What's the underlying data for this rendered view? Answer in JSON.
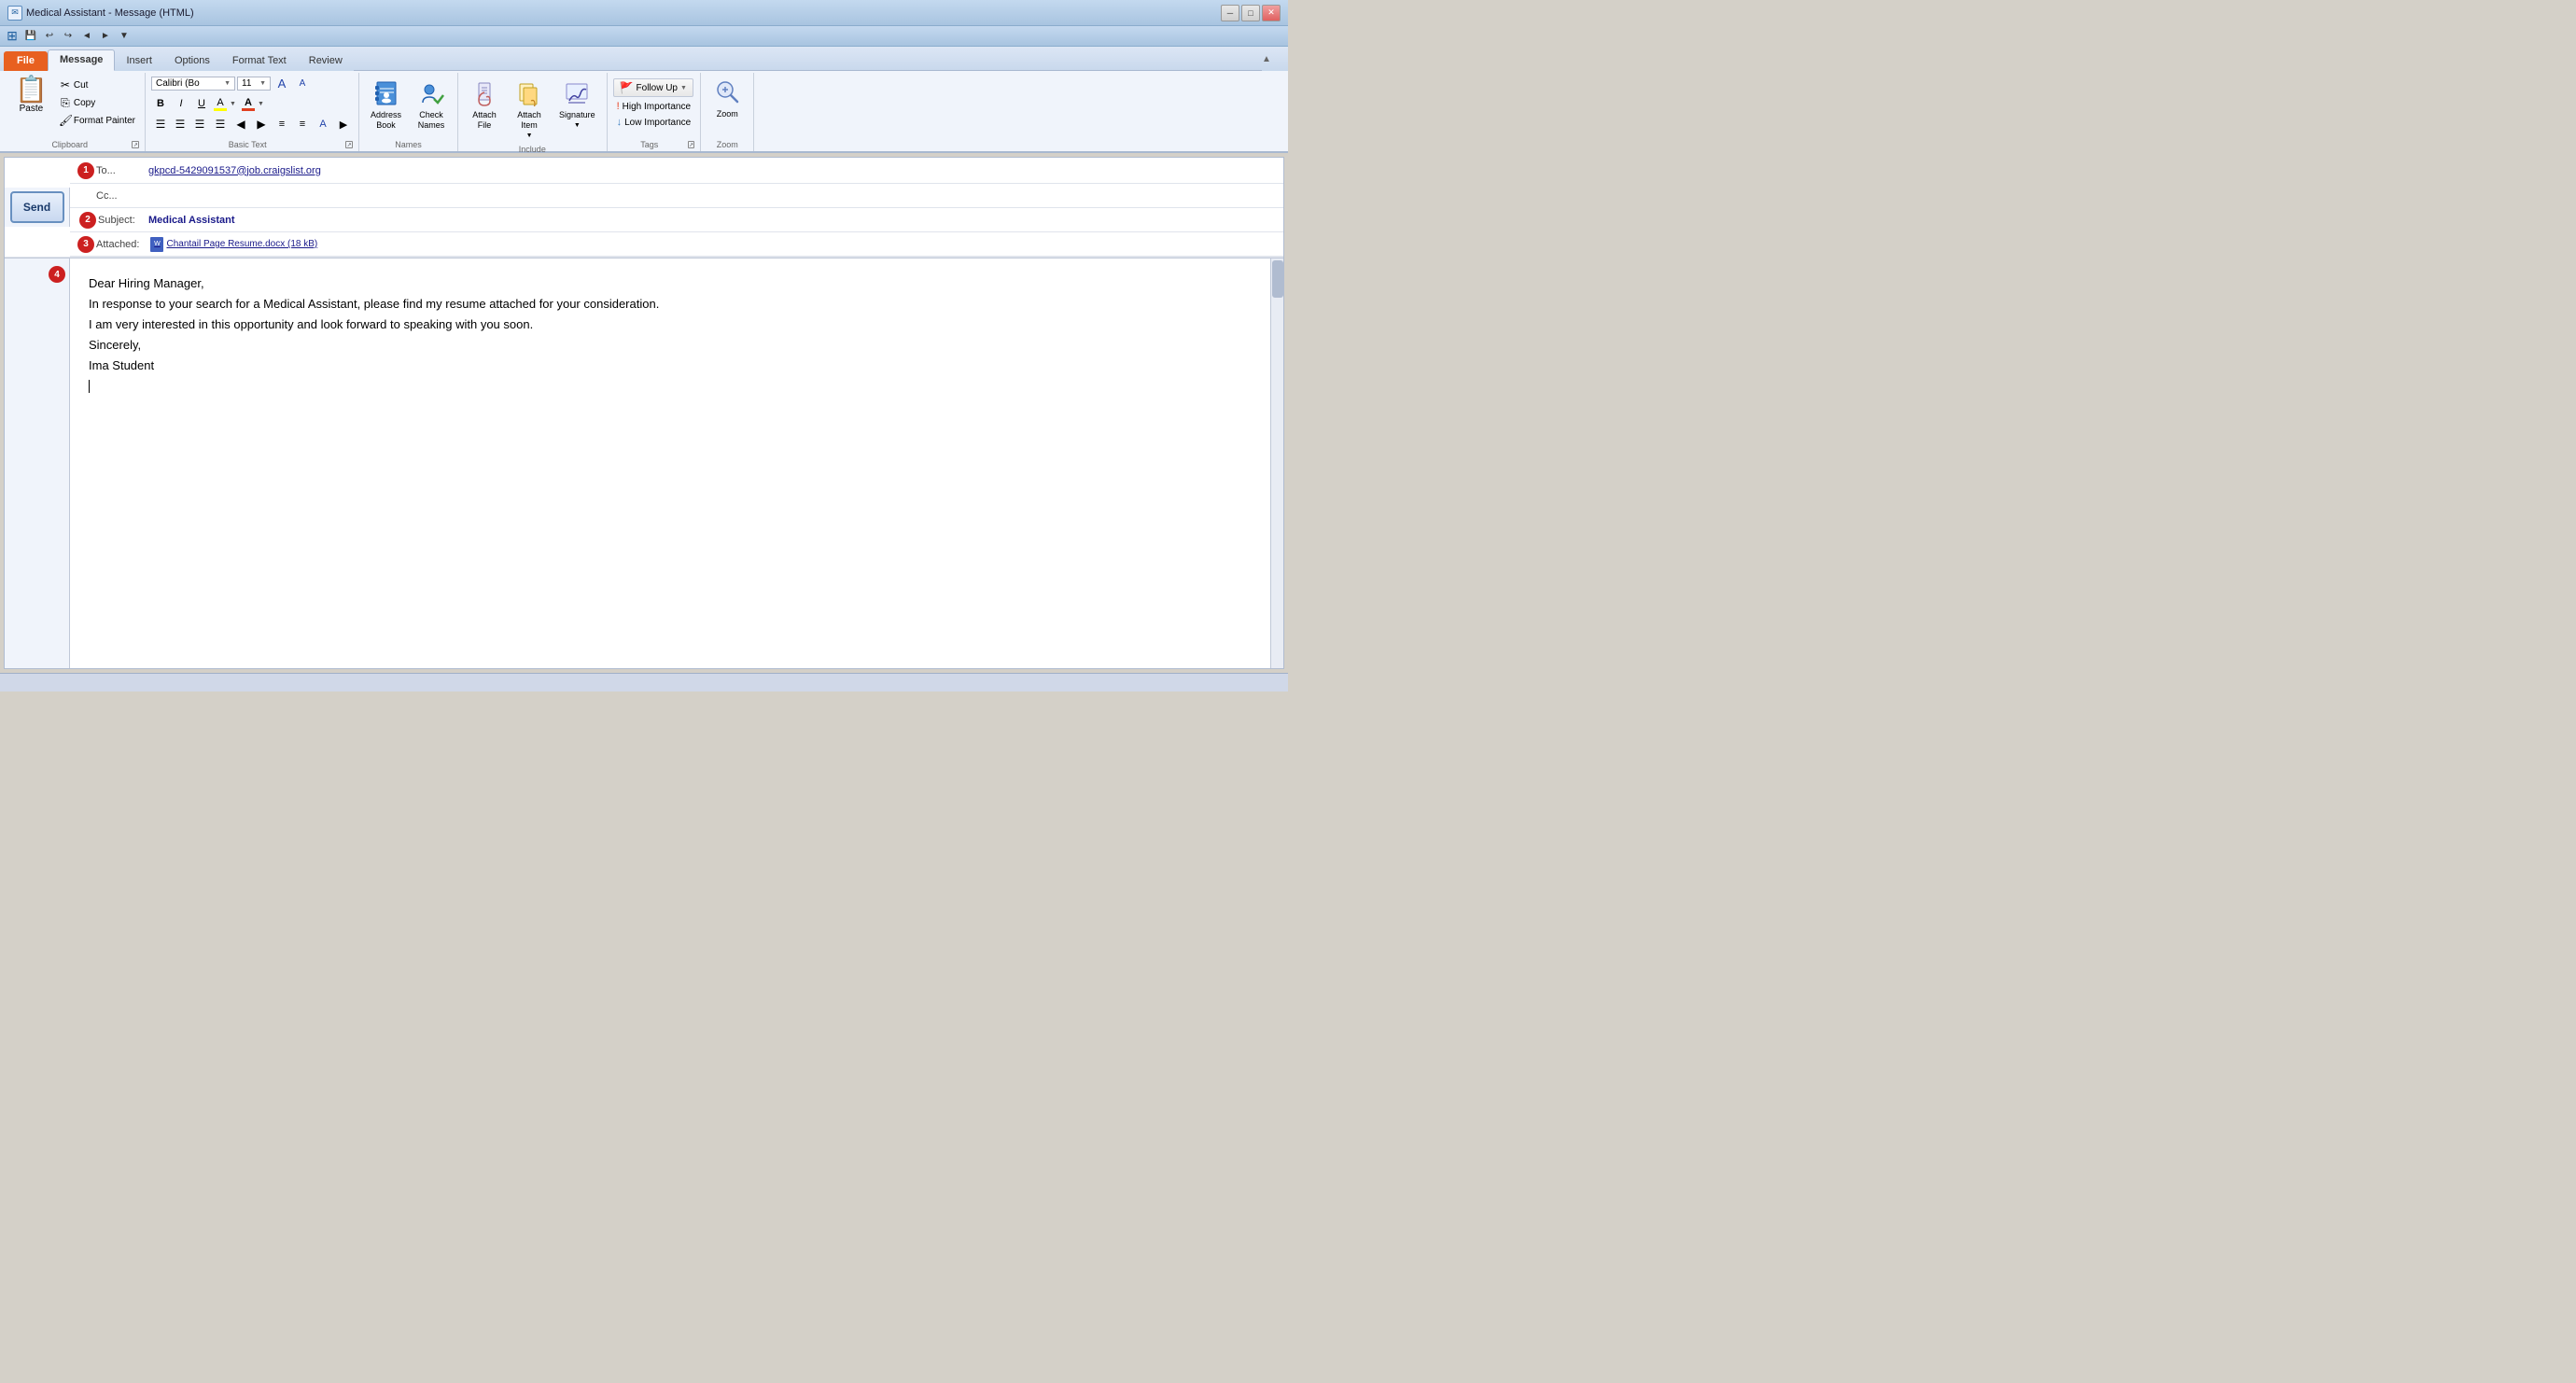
{
  "titleBar": {
    "title": "Medical Assistant - Message (HTML)",
    "controls": [
      "minimize",
      "restore",
      "close"
    ]
  },
  "quickToolbar": {
    "buttons": [
      "save",
      "undo",
      "redo",
      "back",
      "forward",
      "dropdown"
    ]
  },
  "ribbonTabs": {
    "active": "Message",
    "tabs": [
      "File",
      "Message",
      "Insert",
      "Options",
      "Format Text",
      "Review"
    ]
  },
  "ribbon": {
    "groups": {
      "clipboard": {
        "label": "Clipboard",
        "paste": "Paste",
        "cut": "Cut",
        "copy": "Copy",
        "formatPainter": "Format Painter"
      },
      "basicText": {
        "label": "Basic Text",
        "font": "Calibri (Bo",
        "fontSize": "11",
        "boldLabel": "B",
        "italicLabel": "I",
        "underlineLabel": "U",
        "growFont": "A",
        "shrinkFont": "A",
        "bullets": "☰",
        "numbering": "☰",
        "decreaseIndent": "⇤",
        "increaseIndent": "⇥",
        "textStyles": "A",
        "alignLeft": "≡",
        "alignCenter": "≡",
        "alignRight": "≡",
        "justify": "≡",
        "decreaseBlock": "◄",
        "increaseBlock": "►"
      },
      "names": {
        "label": "Names",
        "addressBook": "Address\nBook",
        "checkNames": "Check\nNames"
      },
      "include": {
        "label": "Include",
        "attachFile": "Attach\nFile",
        "attachItem": "Attach\nItem",
        "signature": "Signature"
      },
      "tags": {
        "label": "Tags",
        "followUp": "Follow Up",
        "highImportance": "High Importance",
        "lowImportance": "Low Importance"
      },
      "zoom": {
        "label": "Zoom",
        "zoom": "Zoom"
      }
    }
  },
  "emailForm": {
    "sendButton": "Send",
    "toLabel": "To...",
    "toAddress": "gkpcd-5429091537@job.craigslist.org",
    "ccLabel": "Cc...",
    "subjectLabel": "Subject:",
    "subjectValue": "Medical Assistant",
    "attachedLabel": "Attached:",
    "attachedFile": "Chantail Page Resume.docx (18 kB)",
    "badge1": "1",
    "badge2": "2",
    "badge3": "3",
    "badge4": "4"
  },
  "emailBody": {
    "line1": "Dear Hiring Manager,",
    "line2": "In response to your search for a Medical Assistant, please find my resume attached for your consideration.",
    "line3": "I am very interested in this opportunity and look forward to speaking with you soon.",
    "line4": "Sincerely,",
    "line5": "Ima Student"
  },
  "statusBar": {
    "text": ""
  }
}
